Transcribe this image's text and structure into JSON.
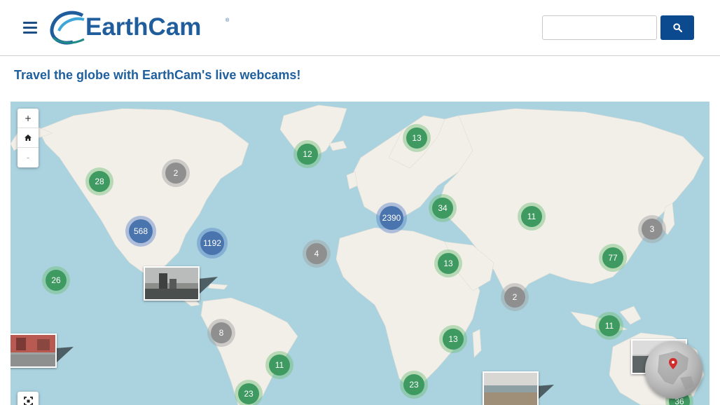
{
  "header": {
    "menu_icon": "hamburger-menu-icon",
    "logo_text": "EarthCam",
    "logo_reg": "®",
    "search_placeholder": "",
    "search_icon": "search-icon"
  },
  "headline": "Travel the globe with EarthCam's live webcams!",
  "map": {
    "zoom_in": "+",
    "home_icon": "home-icon",
    "zoom_out": "-",
    "fullscreen_icon": "fullscreen-icon",
    "clusters": [
      {
        "label": "28",
        "style": "green"
      },
      {
        "label": "2",
        "style": "gray"
      },
      {
        "label": "12",
        "style": "green"
      },
      {
        "label": "13",
        "style": "green"
      },
      {
        "label": "568",
        "style": "blue"
      },
      {
        "label": "1192",
        "style": "blue"
      },
      {
        "label": "2390",
        "style": "blue"
      },
      {
        "label": "34",
        "style": "green"
      },
      {
        "label": "11",
        "style": "green"
      },
      {
        "label": "3",
        "style": "gray"
      },
      {
        "label": "4",
        "style": "gray"
      },
      {
        "label": "26",
        "style": "green"
      },
      {
        "label": "13",
        "style": "green"
      },
      {
        "label": "77",
        "style": "green"
      },
      {
        "label": "2",
        "style": "gray"
      },
      {
        "label": "8",
        "style": "gray"
      },
      {
        "label": "11",
        "style": "green"
      },
      {
        "label": "13",
        "style": "green"
      },
      {
        "label": "11",
        "style": "green"
      },
      {
        "label": "23",
        "style": "green"
      },
      {
        "label": "23",
        "style": "green"
      },
      {
        "label": "36",
        "style": "green"
      }
    ],
    "colors": {
      "ocean": "#aad3df",
      "land": "#f2efe9",
      "cluster_green": "#3f9a62",
      "cluster_gray": "#8f8f8f",
      "cluster_blue": "#4a74ad",
      "brand_blue": "#1f5d9c"
    }
  }
}
